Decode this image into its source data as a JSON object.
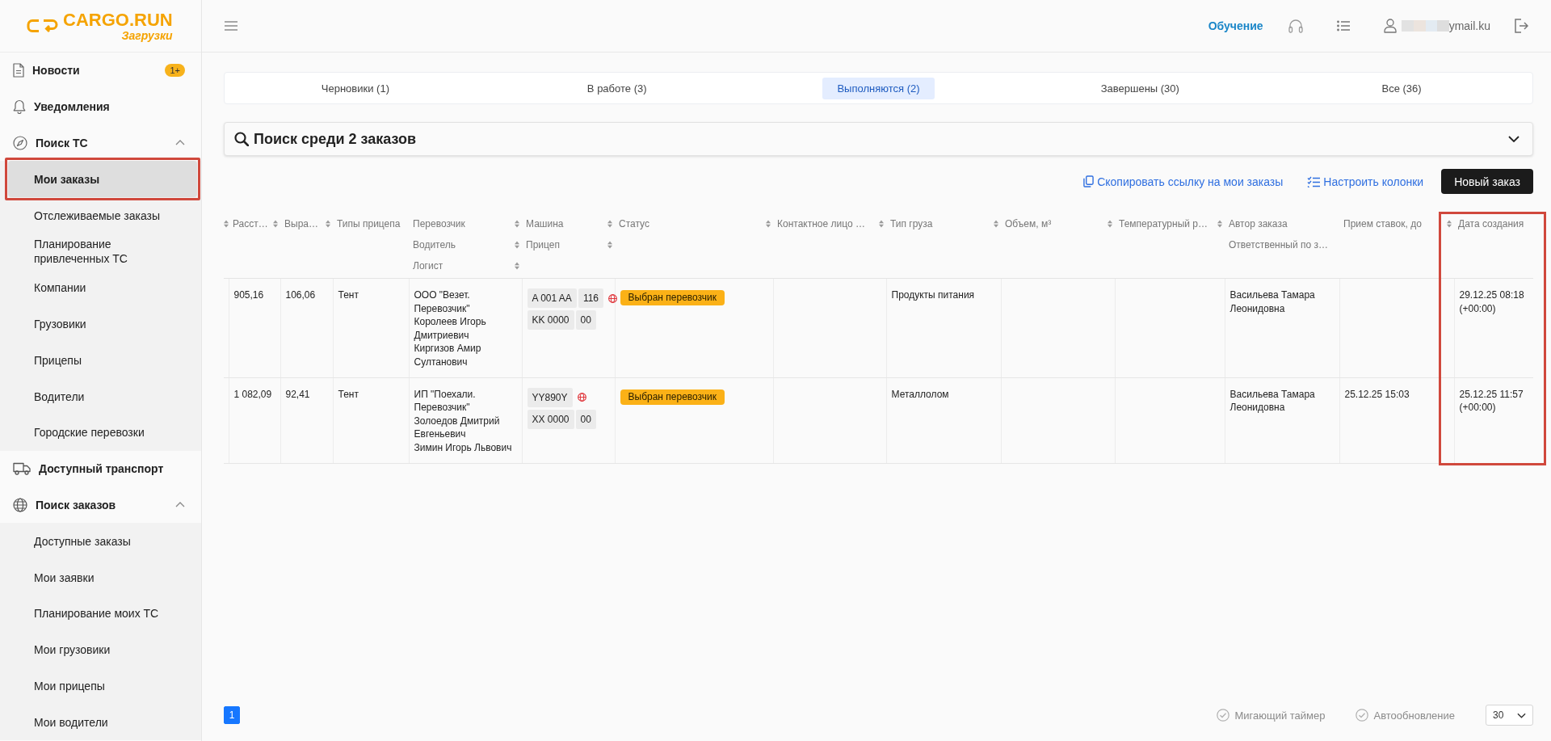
{
  "sidebar": {
    "logo": {
      "title": "CARGO.RUN",
      "subtitle": "Загрузки"
    },
    "items": [
      {
        "label": "Новости",
        "badge": "1+",
        "selected": false,
        "annotated": false
      },
      {
        "label": "Уведомления",
        "selected": false,
        "annotated": false
      },
      {
        "label": "Поиск ТС",
        "expanded": true,
        "selected": false,
        "annotated": false,
        "children": [
          {
            "label": "Мои заказы",
            "selected": true,
            "annotated": true
          },
          {
            "label": "Отслеживаемые заказы",
            "selected": false,
            "annotated": false
          },
          {
            "label": "Планирование привлеченных ТС",
            "selected": false,
            "annotated": false
          },
          {
            "label": "Компании",
            "selected": false,
            "annotated": false
          },
          {
            "label": "Грузовики",
            "selected": false,
            "annotated": false
          },
          {
            "label": "Прицепы",
            "selected": false,
            "annotated": false
          },
          {
            "label": "Водители",
            "selected": false,
            "annotated": false
          },
          {
            "label": "Городские перевозки",
            "selected": false,
            "annotated": false
          }
        ]
      },
      {
        "label": "Доступный транспорт",
        "selected": false,
        "annotated": false
      },
      {
        "label": "Поиск заказов",
        "expanded": true,
        "selected": false,
        "annotated": false,
        "children": [
          {
            "label": "Доступные заказы",
            "selected": false,
            "annotated": false
          },
          {
            "label": "Мои заявки",
            "selected": false,
            "annotated": false
          },
          {
            "label": "Планирование моих ТС",
            "selected": false,
            "annotated": false
          },
          {
            "label": "Мои грузовики",
            "selected": false,
            "annotated": false
          },
          {
            "label": "Мои прицепы",
            "selected": false,
            "annotated": false
          },
          {
            "label": "Мои водители",
            "selected": false,
            "annotated": false
          }
        ]
      }
    ]
  },
  "header": {
    "links": [
      {
        "label": "Обучение"
      }
    ],
    "user": {
      "email": "ymail.ku",
      "redacted": true
    }
  },
  "tabs": [
    {
      "label": "Черновики (1)",
      "selected": false
    },
    {
      "label": "В работе (3)",
      "selected": false
    },
    {
      "label": "Выполняются (2)",
      "selected": true
    },
    {
      "label": "Завершены (30)",
      "selected": false
    },
    {
      "label": "Все (36)",
      "selected": false
    }
  ],
  "search": {
    "title": "Поиск среди 2 заказов",
    "expanded": false
  },
  "actions": [
    {
      "kind": "link",
      "label": "Скопировать ссылку на мои заказы"
    },
    {
      "kind": "link",
      "label": "Настроить колонки"
    },
    {
      "kind": "button",
      "label": "Новый заказ"
    }
  ],
  "table": {
    "columns": [
      {
        "annotated": false,
        "headings": [
          {
            "sortable": true
          }
        ]
      },
      {
        "annotated": false,
        "headings": [
          {
            "label": "Расст…",
            "sortable": true
          }
        ]
      },
      {
        "annotated": false,
        "headings": [
          {
            "label": "Выра…",
            "sortable": true
          }
        ]
      },
      {
        "annotated": false,
        "headings": [
          {
            "label": "Типы прицепа",
            "sortable": false
          }
        ]
      },
      {
        "annotated": false,
        "headings": [
          {
            "label": "Перевозчик",
            "sortable": true
          },
          {
            "label": "Водитель",
            "sortable": true
          },
          {
            "label": "Логист",
            "sortable": true
          }
        ]
      },
      {
        "annotated": false,
        "headings": [
          {
            "label": "Машина",
            "sortable": true
          },
          {
            "label": "Прицеп",
            "sortable": true
          }
        ]
      },
      {
        "annotated": false,
        "headings": [
          {
            "label": "Статус",
            "sortable": true
          }
        ]
      },
      {
        "annotated": false,
        "headings": [
          {
            "label": "Контактное лицо …",
            "sortable": true
          }
        ]
      },
      {
        "annotated": false,
        "headings": [
          {
            "label": "Тип груза",
            "sortable": true
          }
        ]
      },
      {
        "annotated": false,
        "headings": [
          {
            "label": "Объем, м³",
            "sortable": true
          }
        ]
      },
      {
        "annotated": false,
        "headings": [
          {
            "label": "Температурный р…",
            "sortable": true
          }
        ]
      },
      {
        "annotated": false,
        "headings": [
          {
            "label": "Автор заказа",
            "sortable": false
          },
          {
            "label": "Ответственный по з…",
            "sortable": false
          }
        ]
      },
      {
        "annotated": false,
        "headings": [
          {
            "label": "Прием ставок, до",
            "sortable": true
          }
        ]
      },
      {
        "annotated": true,
        "headings": [
          {
            "label": "Дата создания",
            "sortable": false
          }
        ]
      }
    ],
    "rows": [
      {
        "cells": [
          null,
          {
            "kind": "text",
            "text": "905,16"
          },
          {
            "kind": "text",
            "text": "106,06"
          },
          {
            "kind": "text",
            "text": "Тент"
          },
          {
            "kind": "stack",
            "lines": [
              "ООО \"Везет. Перевозчик\"",
              "Королеев Игорь Дмитриевич",
              "Киргизов Амир Султанович"
            ]
          },
          {
            "kind": "vehicle",
            "vehicle": {
              "number": "A 001 AA",
              "region": "116",
              "globe_marker": true
            },
            "trailer": {
              "number": "KK 0000",
              "region": "00"
            }
          },
          {
            "kind": "status",
            "label": "Выбран перевозчик"
          },
          null,
          {
            "kind": "text",
            "text": "Продукты питания"
          },
          null,
          null,
          {
            "kind": "text",
            "text": "Васильева Тамара Леонидовна"
          },
          null,
          {
            "kind": "datetime",
            "lines": [
              "29.12.25 08:18",
              "(+00:00)"
            ]
          }
        ]
      },
      {
        "cells": [
          null,
          {
            "kind": "text",
            "text": "1 082,09"
          },
          {
            "kind": "text",
            "text": "92,41"
          },
          {
            "kind": "text",
            "text": "Тент"
          },
          {
            "kind": "stack",
            "lines": [
              "ИП \"Поехали. Перевозчик\"",
              "Золоедов Дмитрий Евгеньевич",
              "Зимин Игорь Львович"
            ]
          },
          {
            "kind": "vehicle",
            "vehicle": {
              "number": "YY890Y",
              "globe_marker": true
            },
            "trailer": {
              "number": "XX 0000",
              "region": "00"
            }
          },
          {
            "kind": "status",
            "label": "Выбран перевозчик"
          },
          null,
          {
            "kind": "text",
            "text": "Металлолом"
          },
          null,
          null,
          {
            "kind": "text",
            "text": "Васильева Тамара Леонидовна"
          },
          {
            "kind": "text",
            "text": "25.12.25 15:03"
          },
          {
            "kind": "datetime",
            "lines": [
              "25.12.25 11:57",
              "(+00:00)"
            ]
          }
        ]
      }
    ]
  },
  "footer": {
    "pages": [
      {
        "label": "1",
        "selected": true
      }
    ],
    "toggles": [
      {
        "label": "Мигающий таймер",
        "checked": false
      },
      {
        "label": "Автообновление",
        "checked": false
      }
    ],
    "page_size": "30"
  }
}
